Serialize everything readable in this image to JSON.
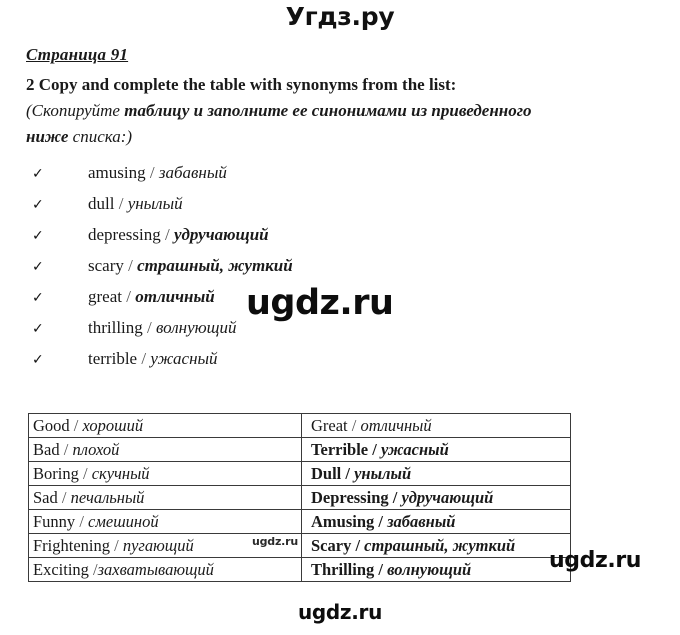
{
  "header": {
    "logo": "Угдз.ру"
  },
  "document": {
    "page_label": "Страница 91",
    "task": {
      "line1_number": "2",
      "line1_text": "Copy and complete the table with synonyms from the list:",
      "line2_open": "(",
      "line2_a": "Скопируйте ",
      "line2_b": "таблицу и заполните ее синонимами из приведенного",
      "line3_b": "ниже",
      "line3_a": " списка:)"
    }
  },
  "checklist": {
    "mark": "✓",
    "items": [
      {
        "english": "amusing",
        "separator": " / ",
        "russian": "забавный",
        "bold": false
      },
      {
        "english": "dull",
        "separator": " / ",
        "russian": "унылый",
        "bold": false
      },
      {
        "english": "depressing",
        "separator": " / ",
        "russian": "удручающий",
        "bold": true
      },
      {
        "english": "scary",
        "separator": " / ",
        "russian": "страшный, жуткий",
        "bold": true
      },
      {
        "english": "great",
        "separator": " / ",
        "russian": "отличный",
        "bold": true
      },
      {
        "english": "thrilling",
        "separator": " / ",
        "russian": "волнующий",
        "bold": false
      },
      {
        "english": "terrible",
        "separator": " / ",
        "russian": "ужасный",
        "bold": false
      }
    ]
  },
  "table": {
    "rows": [
      {
        "left": "Good / хороший",
        "left_en": "Good",
        "left_sep": " / ",
        "left_ru": "хороший",
        "right": "Great / отличный",
        "right_en": "Great",
        "right_sep": " / ",
        "right_ru": "отличный",
        "right_bold": false
      },
      {
        "left": "Bad / плохой",
        "left_en": "Bad",
        "left_sep": " / ",
        "left_ru": "плохой",
        "right": "Terrible / ужасный",
        "right_en": "Terrible",
        "right_sep": " / ",
        "right_ru": "ужасный",
        "right_bold": true
      },
      {
        "left": "Boring / скучный",
        "left_en": "Boring",
        "left_sep": " / ",
        "left_ru": "скучный",
        "right": "Dull / унылый",
        "right_en": "Dull",
        "right_sep": " / ",
        "right_ru": "унылый",
        "right_bold": true
      },
      {
        "left": "Sad / печальный",
        "left_en": "Sad",
        "left_sep": " / ",
        "left_ru": "печальный",
        "right": "Depressing / удручающий",
        "right_en": "Depressing",
        "right_sep": " / ",
        "right_ru": "удручающий",
        "right_bold": true
      },
      {
        "left": "Funny / смешиной",
        "left_en": "Funny",
        "left_sep": " / ",
        "left_ru": "смешиной",
        "right": "Amusing / забавный",
        "right_en": "Amusing",
        "right_sep": " / ",
        "right_ru": "забавный",
        "right_bold": true
      },
      {
        "left": "Frightening / пугающий",
        "left_en": "Frightening",
        "left_sep": " / ",
        "left_ru": "пугающий",
        "right": "Scary / страшный, жуткий",
        "right_en": "Scary",
        "right_sep": " / ",
        "right_ru": "страшный, жуткий",
        "right_bold": true
      },
      {
        "left": "Exciting /захватывающий",
        "left_en": "Exciting",
        "left_sep": " /",
        "left_ru": "захватывающий",
        "right": "Thrilling / волнующий",
        "right_en": "Thrilling",
        "right_sep": " / ",
        "right_ru": "волнующий",
        "right_bold": true
      }
    ]
  },
  "watermarks": {
    "middle": "ugdz.ru",
    "table_overlay": "ugdz.ru",
    "table_right": "ugdz.ru",
    "footer": "ugdz.ru"
  }
}
